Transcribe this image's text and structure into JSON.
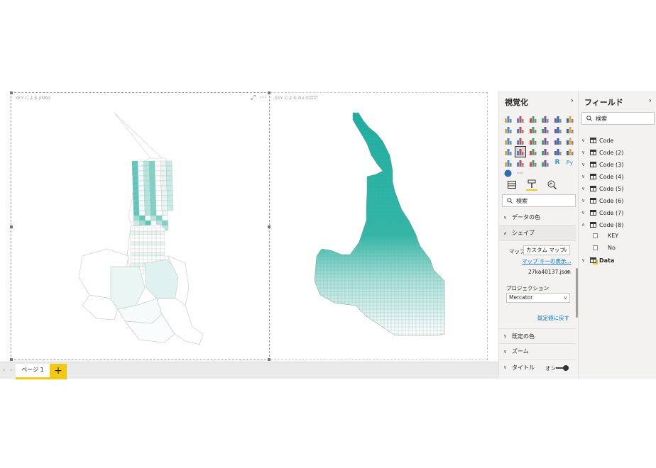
{
  "visuals": {
    "left": {
      "title": "KEY による JINKO"
    },
    "right": {
      "title": "KEY による No の合計"
    }
  },
  "page_bar": {
    "tab_label": "ページ 1",
    "add_label": "+",
    "prev_arrow": "‹",
    "next_arrow": "›"
  },
  "viz_pane": {
    "title": "視覚化",
    "collapse": "›",
    "more_label": "···",
    "r_label": "R",
    "py_label": "Py",
    "search_placeholder": "検索",
    "sections": {
      "data_colors": "データの色",
      "shape": "シェイプ",
      "default_colors": "既定の色",
      "zoom": "ズーム",
      "title": "タイトル"
    },
    "shape": {
      "map_label": "マップ",
      "map_value": "カスタム マップ",
      "map_key_link": "マップ キーの表示...",
      "file_name": "27ka40137.json",
      "file_remove": "✕",
      "projection_label": "プロジェクション",
      "projection_value": "Mercator",
      "reset_link": "既定値に戻す"
    },
    "title_toggle": "オン"
  },
  "fields_pane": {
    "title": "フィールド",
    "collapse": "›",
    "search_placeholder": "検索",
    "tables": [
      "Code",
      "Code (2)",
      "Code (3)",
      "Code (4)",
      "Code (5)",
      "Code (6)",
      "Code (7)",
      "Code (8)"
    ],
    "code8_fields": [
      "KEY",
      "No"
    ],
    "data_table": "Data"
  },
  "colors": {
    "accent": "#f2c811",
    "teal_dark": "#16b0a0",
    "teal_light": "#c8ece8",
    "link": "#0078d4"
  }
}
